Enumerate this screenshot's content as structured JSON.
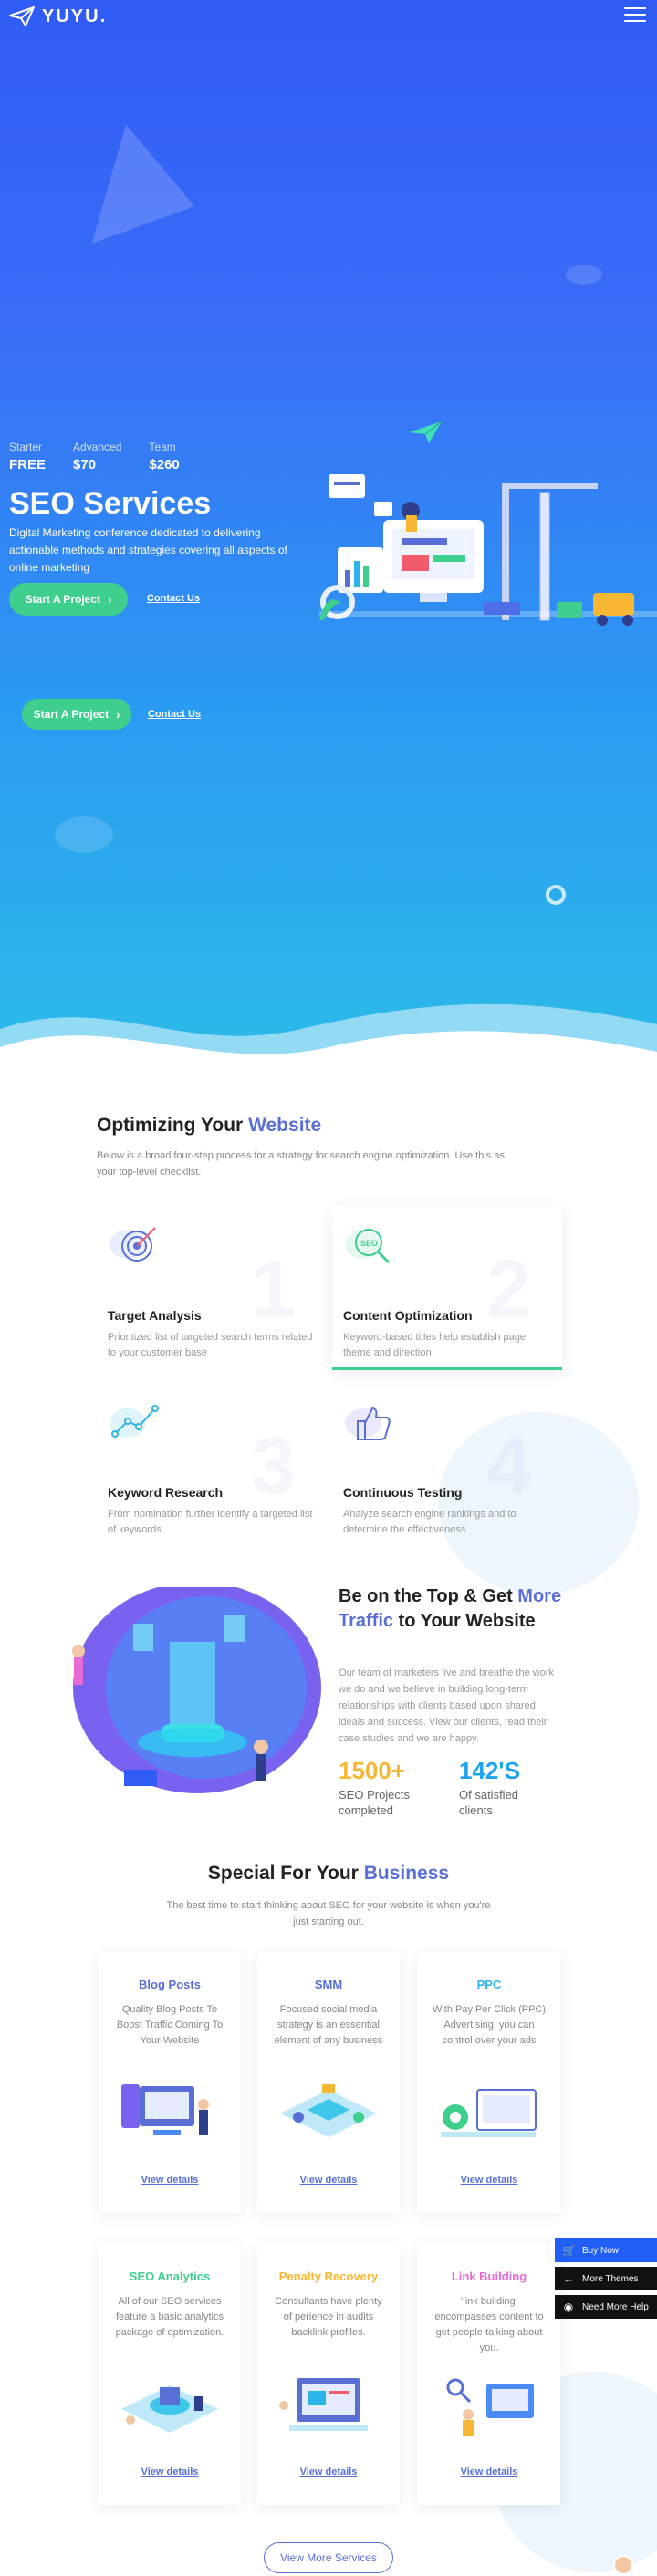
{
  "header": {
    "logo_text": "YUYU."
  },
  "hero": {
    "plans": [
      {
        "name": "Starter",
        "price": "FREE"
      },
      {
        "name": "Advanced",
        "price": "$70"
      },
      {
        "name": "Team",
        "price": "$260"
      }
    ],
    "title": "SEO Services",
    "description": "Digital Marketing conference dedicated to delivering actionable methods and strategies covering all aspects of online marketing",
    "primary_button": "Start A Project",
    "secondary_link": "Contact Us",
    "primary_button_2": "Start A Project",
    "secondary_link_2": "Contact Us"
  },
  "optimizing": {
    "title_prefix": "Optimizing Your ",
    "title_accent": "Website",
    "description": "Below is a broad four-step process for a strategy for search engine optimization. Use this as your top-level checklist.",
    "cards": [
      {
        "number": "1",
        "title": "Target Analysis",
        "desc": "Prioritized list of targeted search terms related to your customer base"
      },
      {
        "number": "2",
        "title": "Content Optimization",
        "desc": "Keyword-based titles help establish page theme and direction"
      },
      {
        "number": "3",
        "title": "Keyword Research",
        "desc": "From nomination further identify a targeted list of keywords"
      },
      {
        "number": "4",
        "title": "Continuous Testing",
        "desc": "Analyze search engine rankings and to determine the effectiveness"
      }
    ]
  },
  "top": {
    "title_part1": "Be on the Top & Get ",
    "title_accent": "More Traffic",
    "title_part2": " to Your Website",
    "description": "Our team of marketers live and breathe the work we do and we believe in building long-term relationships with clients based upon shared ideals and success. View our clients, read their case studies and we are happy.",
    "stats": [
      {
        "value": "1500+",
        "label": "SEO Projects completed"
      },
      {
        "value": "142'S",
        "label": "Of satisfied clients"
      }
    ]
  },
  "special": {
    "title_prefix": "Special For Your ",
    "title_accent": "Business",
    "description": "The best time to start thinking about SEO for your website is when you're just starting out.",
    "services": [
      {
        "title": "Blog Posts",
        "color": "#5a6fd6",
        "desc": "Quality Blog Posts To Boost Traffic Coming To Your Website",
        "link": "View details"
      },
      {
        "title": "SMM",
        "color": "#5a6fd6",
        "desc": "Focused social media strategy is an essential element of any business",
        "link": "View details"
      },
      {
        "title": "PPC",
        "color": "#2bb5e8",
        "desc": "With Pay Per Click (PPC) Advertising, you can control over your ads",
        "link": "View details"
      },
      {
        "title": "SEO Analytics",
        "color": "#3ecf8e",
        "desc": "All of our SEO services feature a basic analytics package of optimization.",
        "link": "View details"
      },
      {
        "title": "Penalty Recovery",
        "color": "#f7b733",
        "desc": "Consultants have plenty of perience in audits backlink profiles.",
        "link": "View details"
      },
      {
        "title": "Link Building",
        "color": "#e86ad6",
        "desc": "'link building' encompasses content to get people talking about you.",
        "link": "View details"
      }
    ],
    "view_more": "View More Services"
  },
  "side_widget": {
    "buy_now": "Buy Now",
    "more_themes": "More Themes",
    "need_help": "Need More Help"
  }
}
